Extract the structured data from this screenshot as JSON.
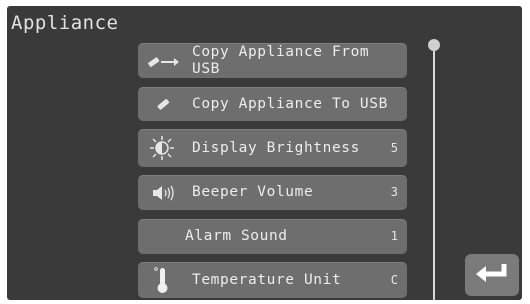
{
  "header": {
    "title": "Appliance"
  },
  "menu": {
    "items": [
      {
        "label": "Copy Appliance From USB",
        "value": "",
        "icon": "usb-import-icon"
      },
      {
        "label": "Copy Appliance To USB",
        "value": "",
        "icon": "usb-stick-icon"
      },
      {
        "label": "Display Brightness",
        "value": "5",
        "icon": "brightness-icon"
      },
      {
        "label": "Beeper Volume",
        "value": "3",
        "icon": "speaker-icon"
      },
      {
        "label": "Alarm Sound",
        "value": "1",
        "icon": ""
      },
      {
        "label": "Temperature Unit",
        "value": "C",
        "icon": "thermometer-icon"
      }
    ]
  },
  "scroll": {
    "position": 0
  },
  "back_button": {
    "icon": "return-arrow-icon"
  }
}
